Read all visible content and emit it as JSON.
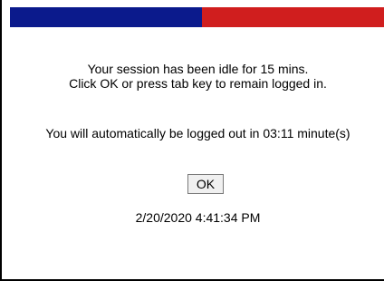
{
  "colors": {
    "band_blue": "#0b1a8c",
    "band_red": "#d01e1e",
    "border": "#000000"
  },
  "message": {
    "idle_line1": "Your session has been idle for 15 mins.",
    "idle_line2": "Click OK or press tab key to remain logged in.",
    "countdown_prefix": "You will automatically be logged out in ",
    "countdown": "03:11",
    "countdown_suffix": " minute(s)"
  },
  "buttons": {
    "ok_label": "OK"
  },
  "timestamp": "2/20/2020 4:41:34 PM"
}
